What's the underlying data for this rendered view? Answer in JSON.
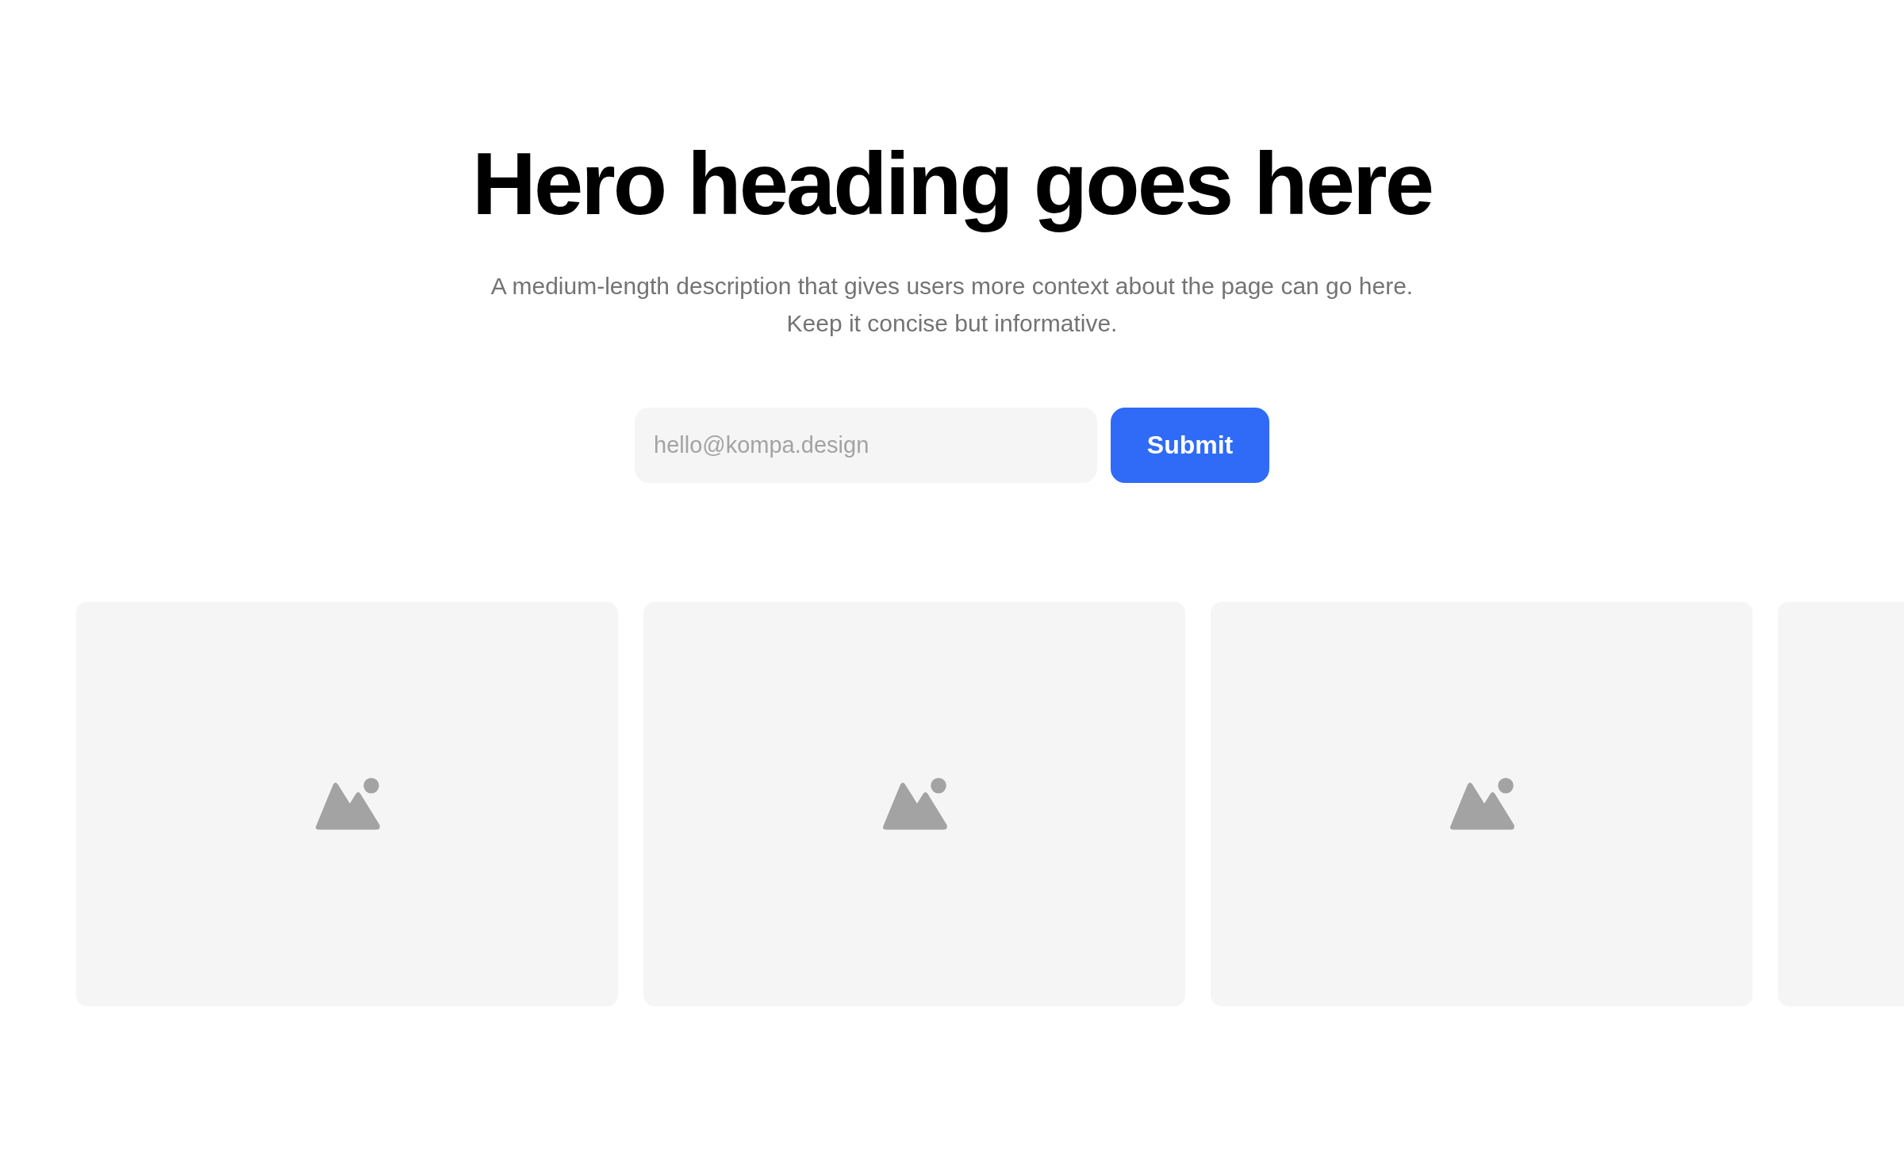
{
  "hero": {
    "heading": "Hero heading goes here",
    "description": "A medium-length description that gives users more context about the page can go here. Keep it concise but informative."
  },
  "signup": {
    "email_placeholder": "hello@kompa.design",
    "button": "Submit"
  },
  "cards": [
    {
      "kind": "image"
    },
    {
      "kind": "image"
    },
    {
      "kind": "image"
    },
    {
      "kind": "cut_off"
    }
  ]
}
